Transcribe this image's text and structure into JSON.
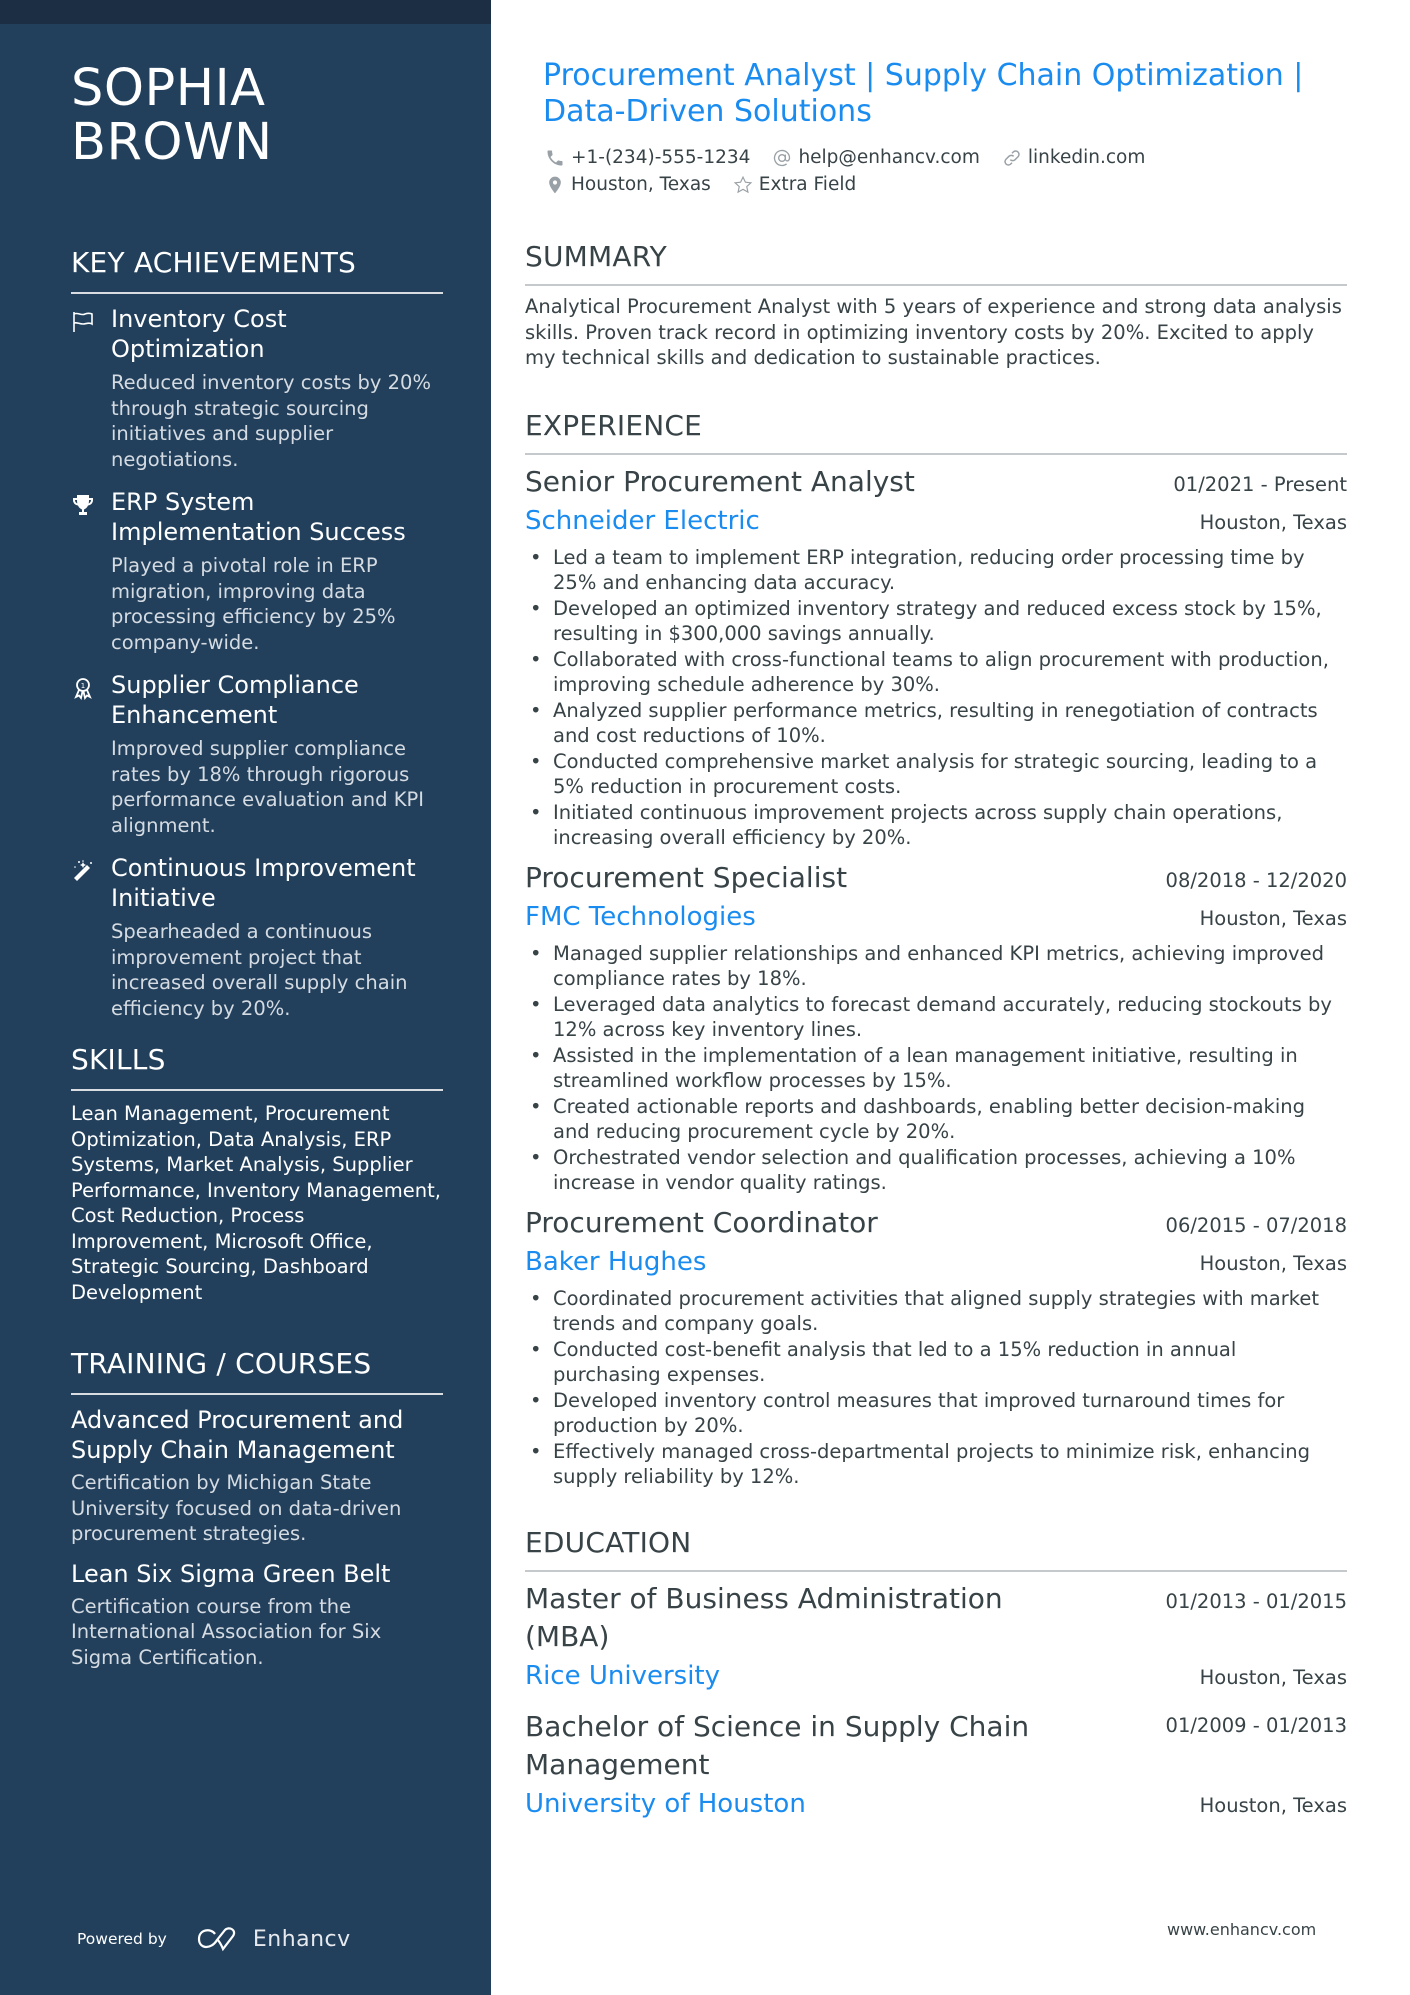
{
  "sidebar": {
    "name_line1": "SOPHIA",
    "name_line2": "BROWN",
    "achievements": {
      "title": "KEY ACHIEVEMENTS",
      "items": [
        {
          "icon": "flag-icon",
          "title": "Inventory Cost Optimization",
          "desc": "Reduced inventory costs by 20% through strategic sourcing initiatives and supplier negotiations."
        },
        {
          "icon": "trophy-icon",
          "title": "ERP System Implementation Success",
          "desc": "Played a pivotal role in ERP migration, improving data processing efficiency by 25% company-wide."
        },
        {
          "icon": "award-ribbon-icon",
          "title": "Supplier Compliance Enhancement",
          "desc": "Improved supplier compliance rates by 18% through rigorous performance evaluation and KPI alignment."
        },
        {
          "icon": "magic-wand-icon",
          "title": "Continuous Improvement Initiative",
          "desc": "Spearheaded a continuous improvement project that increased overall supply chain efficiency by 20%."
        }
      ]
    },
    "skills": {
      "title": "SKILLS",
      "text": "Lean Management, Procurement Optimization, Data Analysis, ERP Systems, Market Analysis, Supplier Performance, Inventory Management, Cost Reduction, Process Improvement, Microsoft Office, Strategic Sourcing, Dashboard Development"
    },
    "training": {
      "title": "TRAINING / COURSES",
      "items": [
        {
          "title": "Advanced Procurement and Supply Chain Management",
          "desc": "Certification by Michigan State University focused on data-driven procurement strategies."
        },
        {
          "title": "Lean Six Sigma Green Belt",
          "desc": "Certification course from the International Association for Six Sigma Certification."
        }
      ]
    },
    "footer": {
      "powered_by": "Powered by",
      "brand": "Enhancv"
    }
  },
  "header": {
    "headline": "Procurement Analyst | Supply Chain Optimization | Data-Driven Solutions",
    "contacts": {
      "phone": "+1-(234)-555-1234",
      "email": "help@enhancv.com",
      "link": "linkedin.com",
      "location": "Houston, Texas",
      "extra": "Extra Field"
    }
  },
  "summary": {
    "title": "SUMMARY",
    "text": "Analytical Procurement Analyst with 5 years of experience and strong data analysis skills. Proven track record in optimizing inventory costs by 20%. Excited to apply my technical skills and dedication to sustainable practices."
  },
  "experience": {
    "title": "EXPERIENCE",
    "jobs": [
      {
        "title": "Senior Procurement Analyst",
        "dates": "01/2021 - Present",
        "company": "Schneider Electric",
        "location": "Houston, Texas",
        "bullets": [
          "Led a team to implement ERP integration, reducing order processing time by 25% and enhancing data accuracy.",
          "Developed an optimized inventory strategy and reduced excess stock by 15%, resulting in $300,000 savings annually.",
          "Collaborated with cross-functional teams to align procurement with production, improving schedule adherence by 30%.",
          "Analyzed supplier performance metrics, resulting in renegotiation of contracts and cost reductions of 10%.",
          "Conducted comprehensive market analysis for strategic sourcing, leading to a 5% reduction in procurement costs.",
          "Initiated continuous improvement projects across supply chain operations, increasing overall efficiency by 20%."
        ]
      },
      {
        "title": "Procurement Specialist",
        "dates": "08/2018 - 12/2020",
        "company": "FMC Technologies",
        "location": "Houston, Texas",
        "bullets": [
          "Managed supplier relationships and enhanced KPI metrics, achieving improved compliance rates by 18%.",
          "Leveraged data analytics to forecast demand accurately, reducing stockouts by 12% across key inventory lines.",
          "Assisted in the implementation of a lean management initiative, resulting in streamlined workflow processes by 15%.",
          "Created actionable reports and dashboards, enabling better decision-making and reducing procurement cycle by 20%.",
          "Orchestrated vendor selection and qualification processes, achieving a 10% increase in vendor quality ratings."
        ]
      },
      {
        "title": "Procurement Coordinator",
        "dates": "06/2015 - 07/2018",
        "company": "Baker Hughes",
        "location": "Houston, Texas",
        "bullets": [
          "Coordinated procurement activities that aligned supply strategies with market trends and company goals.",
          "Conducted cost-benefit analysis that led to a 15% reduction in annual purchasing expenses.",
          "Developed inventory control measures that improved turnaround times for production by 20%.",
          "Effectively managed cross-departmental projects to minimize risk, enhancing supply reliability by 12%."
        ]
      }
    ]
  },
  "education": {
    "title": "EDUCATION",
    "items": [
      {
        "degree": "Master of Business Administration (MBA)",
        "dates": "01/2013 - 01/2015",
        "school": "Rice University",
        "location": "Houston, Texas"
      },
      {
        "degree": "Bachelor of Science in Supply Chain Management",
        "dates": "01/2009 - 01/2013",
        "school": "University of Houston",
        "location": "Houston, Texas"
      }
    ]
  },
  "footer": {
    "website": "www.enhancv.com"
  },
  "colors": {
    "sidebar": "#22405c",
    "accent": "#1a8cf0",
    "text": "#384347"
  }
}
